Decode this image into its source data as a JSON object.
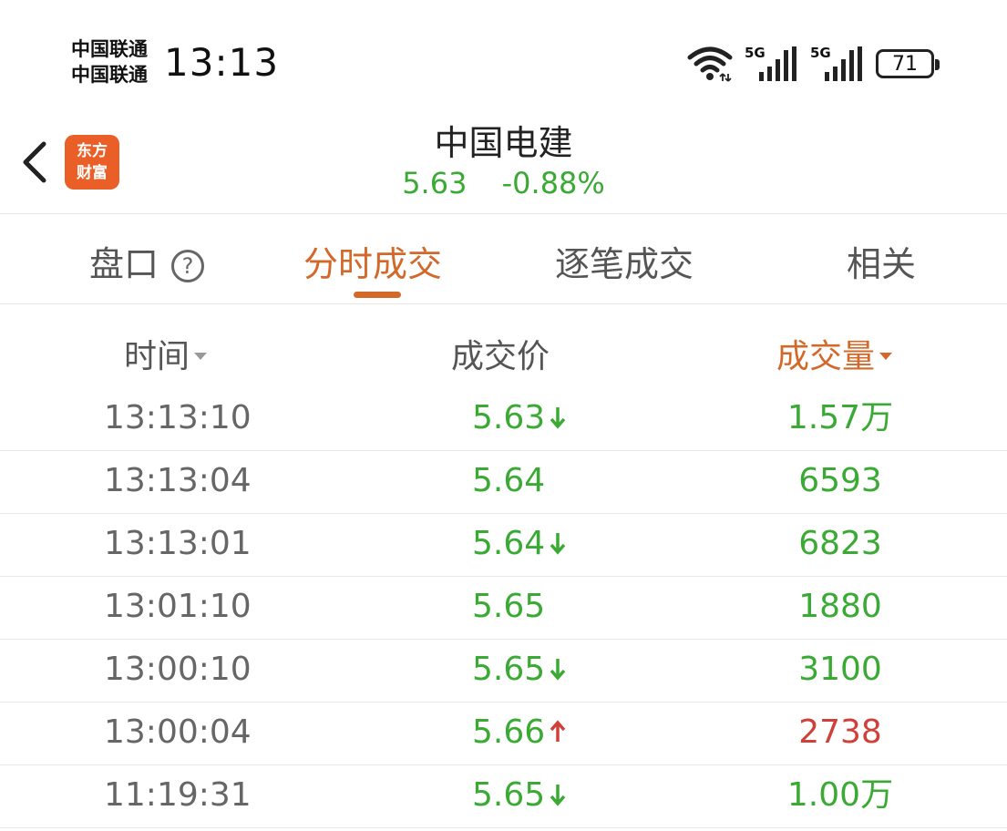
{
  "status_bar": {
    "carrier_1": "中国联通",
    "carrier_2": "中国联通",
    "time": "13:13",
    "signal_1_label": "5G",
    "signal_2_label": "5G",
    "battery": "71"
  },
  "header": {
    "logo_line1": "东方",
    "logo_line2": "财富",
    "stock_name": "中国电建",
    "price": "5.63",
    "change_pct": "-0.88%"
  },
  "tabs": [
    {
      "label": "盘口",
      "active": false
    },
    {
      "label": "分时成交",
      "active": true
    },
    {
      "label": "逐笔成交",
      "active": false
    },
    {
      "label": "相关",
      "active": false
    }
  ],
  "table": {
    "columns": {
      "time": "时间",
      "price": "成交价",
      "volume": "成交量"
    },
    "rows": [
      {
        "time": "13:13:10",
        "price": "5.63",
        "direction": "down",
        "volume": "1.57万",
        "volume_color": "green"
      },
      {
        "time": "13:13:04",
        "price": "5.64",
        "direction": "none",
        "volume": "6593",
        "volume_color": "green"
      },
      {
        "time": "13:13:01",
        "price": "5.64",
        "direction": "down",
        "volume": "6823",
        "volume_color": "green"
      },
      {
        "time": "13:01:10",
        "price": "5.65",
        "direction": "none",
        "volume": "1880",
        "volume_color": "green"
      },
      {
        "time": "13:00:10",
        "price": "5.65",
        "direction": "down",
        "volume": "3100",
        "volume_color": "green"
      },
      {
        "time": "13:00:04",
        "price": "5.66",
        "direction": "up",
        "volume": "2738",
        "volume_color": "red"
      },
      {
        "time": "11:19:31",
        "price": "5.65",
        "direction": "down",
        "volume": "1.00万",
        "volume_color": "green"
      }
    ]
  },
  "colors": {
    "up": "#d0403a",
    "down": "#3aaa35",
    "accent": "#d2692a",
    "logo": "#ea5e27"
  }
}
